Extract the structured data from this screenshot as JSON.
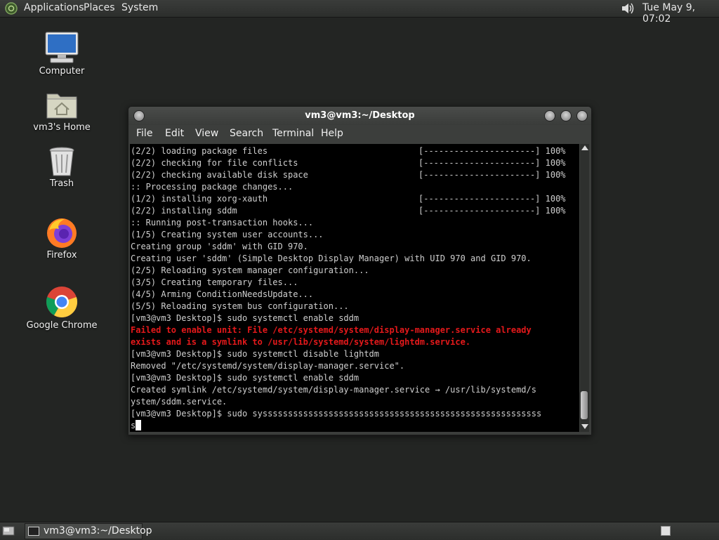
{
  "top_panel": {
    "menus": [
      "Applications",
      "Places",
      "System"
    ],
    "clock": "Tue May  9, 07:02",
    "logo_icon": "os-logo-icon",
    "volume_icon": "speaker-icon"
  },
  "desktop_icons": [
    {
      "label": "Computer",
      "icon": "computer-icon"
    },
    {
      "label": "vm3's Home",
      "icon": "home-folder-icon"
    },
    {
      "label": "Trash",
      "icon": "trash-icon"
    },
    {
      "label": "Firefox",
      "icon": "firefox-icon"
    },
    {
      "label": "Google Chrome",
      "icon": "chrome-icon"
    }
  ],
  "terminal": {
    "title": "vm3@vm3:~/Desktop",
    "menu": [
      "File",
      "Edit",
      "View",
      "Search",
      "Terminal",
      "Help"
    ],
    "progress_bar": "[----------------------] 100%",
    "lines": [
      {
        "text": "(2/2) loading package files",
        "progress": true
      },
      {
        "text": "(2/2) checking for file conflicts",
        "progress": true
      },
      {
        "text": "(2/2) checking available disk space",
        "progress": true
      },
      {
        "text": ":: Processing package changes..."
      },
      {
        "text": "(1/2) installing xorg-xauth",
        "progress": true
      },
      {
        "text": "(2/2) installing sddm",
        "progress": true
      },
      {
        "text": ":: Running post-transaction hooks..."
      },
      {
        "text": "(1/5) Creating system user accounts..."
      },
      {
        "text": "Creating group 'sddm' with GID 970."
      },
      {
        "text": "Creating user 'sddm' (Simple Desktop Display Manager) with UID 970 and GID 970."
      },
      {
        "text": "(2/5) Reloading system manager configuration..."
      },
      {
        "text": "(3/5) Creating temporary files..."
      },
      {
        "text": "(4/5) Arming ConditionNeedsUpdate..."
      },
      {
        "text": "(5/5) Reloading system bus configuration..."
      },
      {
        "text": "[vm3@vm3 Desktop]$ sudo systemctl enable sddm"
      },
      {
        "text": "Failed to enable unit: File /etc/systemd/system/display-manager.service already",
        "error": true
      },
      {
        "text": "exists and is a symlink to /usr/lib/systemd/system/lightdm.service.",
        "error": true
      },
      {
        "text": "[vm3@vm3 Desktop]$ sudo systemctl disable lightdm"
      },
      {
        "text": "Removed \"/etc/systemd/system/display-manager.service\"."
      },
      {
        "text": "[vm3@vm3 Desktop]$ sudo systemctl enable sddm"
      },
      {
        "text": "Created symlink /etc/systemd/system/display-manager.service → /usr/lib/systemd/s"
      },
      {
        "text": "ystem/sddm.service."
      },
      {
        "text": "[vm3@vm3 Desktop]$ sudo sysssssssssssssssssssssssssssssssssssssssssssssssssssssss"
      },
      {
        "text": "s",
        "cursor": true
      }
    ]
  },
  "taskbar": {
    "task": "vm3@vm3:~/Desktop",
    "show_desktop_icon": "show-desktop-icon",
    "workspace_icon": "workspace-switcher-icon"
  },
  "colors": {
    "error_text": "#e5191b",
    "terminal_bg": "#000000",
    "terminal_fg": "#cfcfcf",
    "desktop_bg": "#232523"
  }
}
